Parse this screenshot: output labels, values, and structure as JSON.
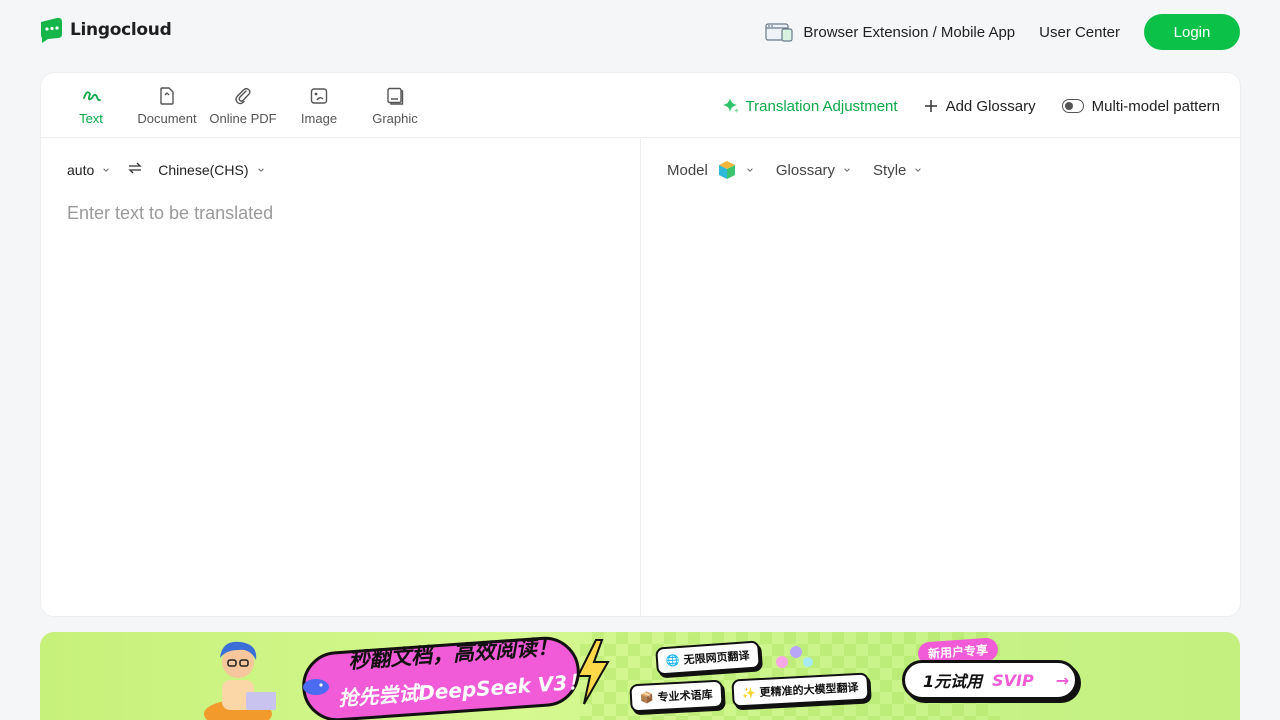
{
  "header": {
    "logo_text": "Lingocloud",
    "extension_label": "Browser Extension / Mobile App",
    "user_center_label": "User Center",
    "login_label": "Login"
  },
  "toolbar": {
    "tabs": [
      {
        "label": "Text",
        "icon": "scribble-icon",
        "active": true
      },
      {
        "label": "Document",
        "icon": "document-icon",
        "active": false
      },
      {
        "label": "Online PDF",
        "icon": "paperclip-icon",
        "active": false
      },
      {
        "label": "Image",
        "icon": "image-icon",
        "active": false
      },
      {
        "label": "Graphic",
        "icon": "graphic-icon",
        "active": false
      }
    ],
    "translation_adjustment_label": "Translation Adjustment",
    "add_glossary_label": "Add Glossary",
    "multi_model_label": "Multi-model pattern"
  },
  "source": {
    "from_lang": "auto",
    "to_lang": "Chinese(CHS)",
    "placeholder": "Enter text to be translated",
    "value": ""
  },
  "target": {
    "model_label": "Model",
    "glossary_label": "Glossary",
    "style_label": "Style"
  },
  "banner": {
    "headline": "秒翻文档，高效阅读！",
    "subline": "抢先尝试DeepSeek V3！",
    "tags": [
      "无限网页翻译",
      "专业术语库",
      "更精准的大模型翻译"
    ],
    "new_user_label": "新用户专享",
    "svip_prefix": "1元试用",
    "svip_suffix": "SVIP"
  },
  "colors": {
    "accent": "#0bc148",
    "active_tab": "#0ba84a",
    "banner_pink": "#f25bd8"
  }
}
